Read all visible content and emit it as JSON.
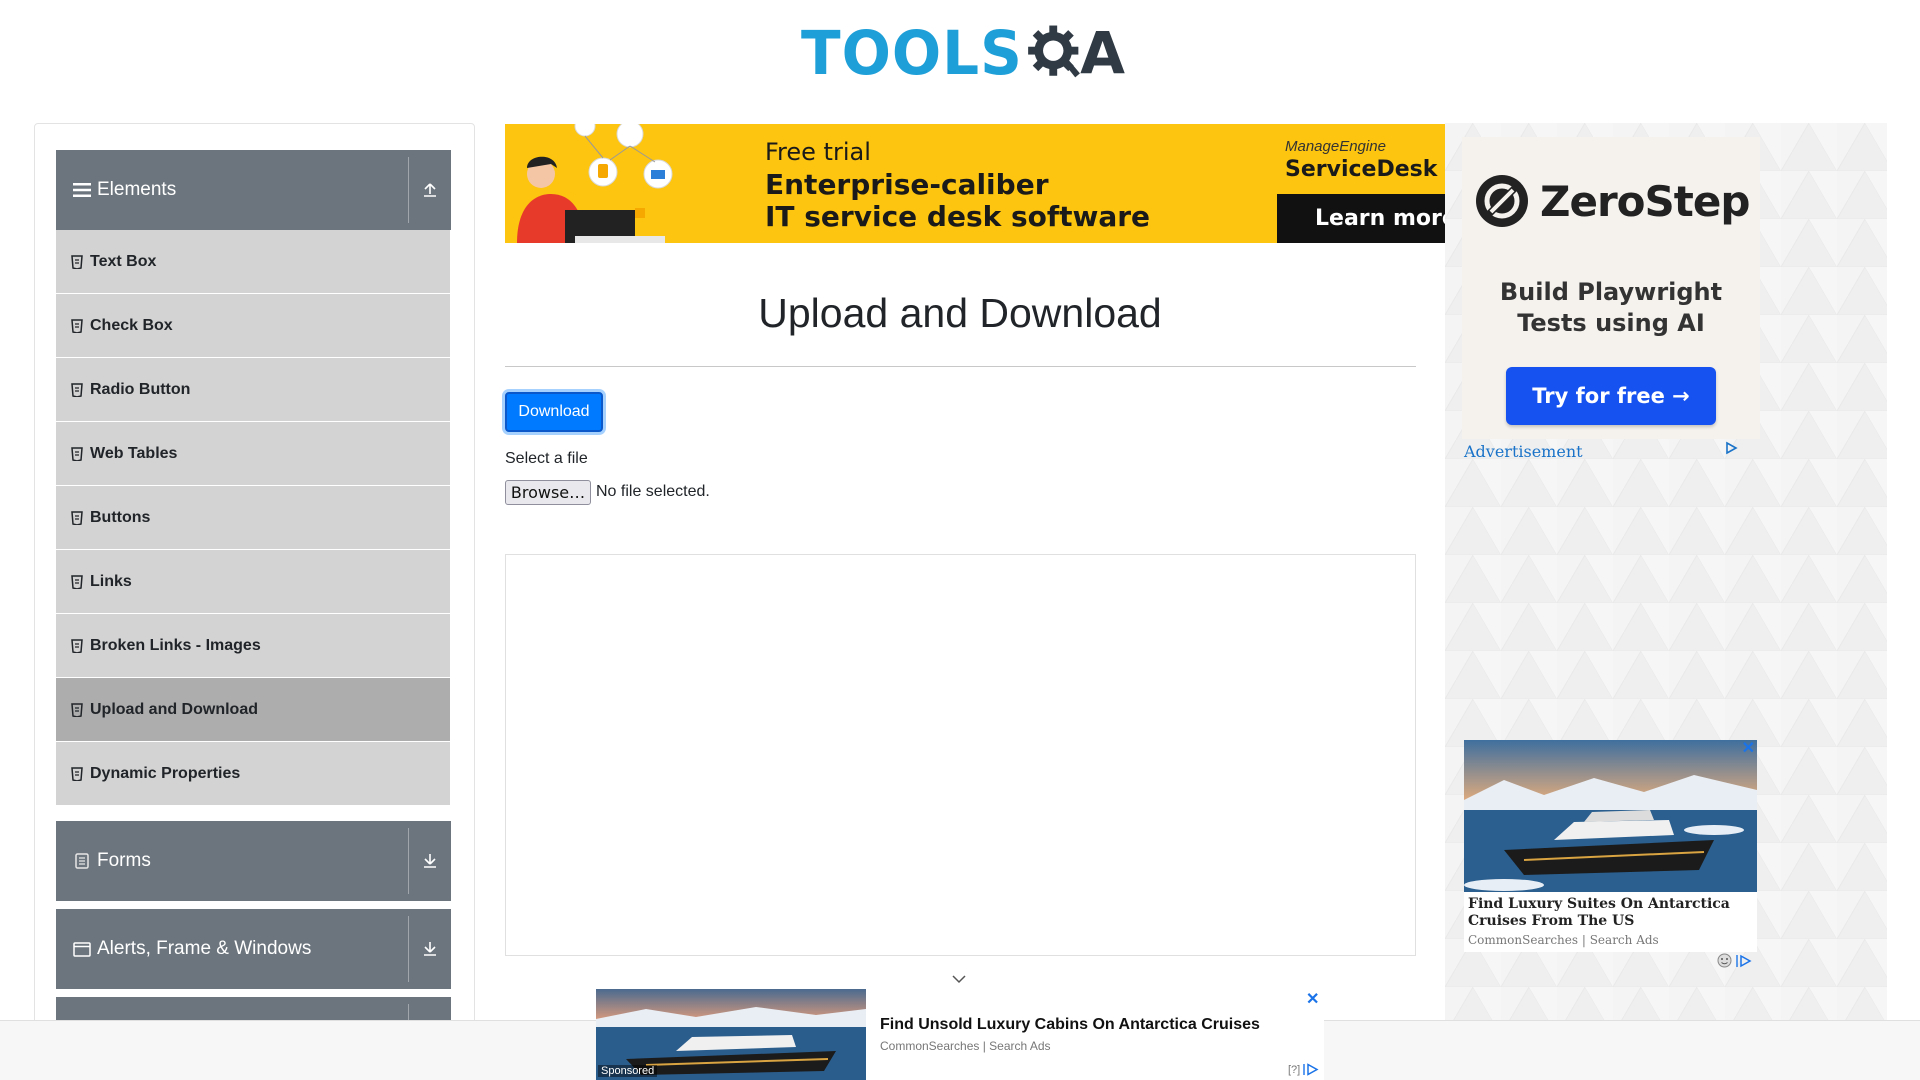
{
  "header": {
    "logo_text_left": "TOOLS",
    "logo_text_right": "A"
  },
  "sidebar": {
    "groups": [
      {
        "label": "Elements",
        "expanded": true
      },
      {
        "label": "Forms",
        "expanded": false
      },
      {
        "label": "Alerts, Frame & Windows",
        "expanded": false
      }
    ],
    "elements_items": [
      {
        "label": "Text Box",
        "active": false
      },
      {
        "label": "Check Box",
        "active": false
      },
      {
        "label": "Radio Button",
        "active": false
      },
      {
        "label": "Web Tables",
        "active": false
      },
      {
        "label": "Buttons",
        "active": false
      },
      {
        "label": "Links",
        "active": false
      },
      {
        "label": "Broken Links - Images",
        "active": false
      },
      {
        "label": "Upload and Download",
        "active": true
      },
      {
        "label": "Dynamic Properties",
        "active": false
      }
    ]
  },
  "top_ad": {
    "line1": "Free trial",
    "line2": "Enterprise-caliber",
    "line3": "IT service desk software",
    "brand_small": "ManageEngine",
    "brand": "ServiceDesk Plu",
    "cta": "Learn more"
  },
  "main": {
    "title": "Upload and Download",
    "download_label": "Download",
    "select_label": "Select a file",
    "browse_label": "Browse…",
    "no_file_text": "No file selected."
  },
  "right_ad": {
    "brand": "ZeroStep",
    "tagline_line1": "Build Playwright",
    "tagline_line2": "Tests using AI",
    "cta": "Try for free →",
    "advertisement_label": "Advertisement"
  },
  "side_ad": {
    "title": "Find Luxury Suites On Antarctica Cruises From The US",
    "source": "CommonSearches | Search Ads",
    "close": "✕"
  },
  "bottom_ad": {
    "sponsored": "Sponsored",
    "title": "Find Unsold Luxury Cabins On Antarctica Cruises",
    "source": "CommonSearches | Search Ads",
    "help": "[?]",
    "close": "✕"
  },
  "colors": {
    "brand_blue": "#1e9fd8",
    "sidebar_header": "#6c757d",
    "menu_item": "#d3d3d3",
    "menu_item_active": "#adadad",
    "primary_button": "#007bff",
    "ad_yellow": "#fdc50f",
    "zerostep_cta": "#1652f0"
  }
}
